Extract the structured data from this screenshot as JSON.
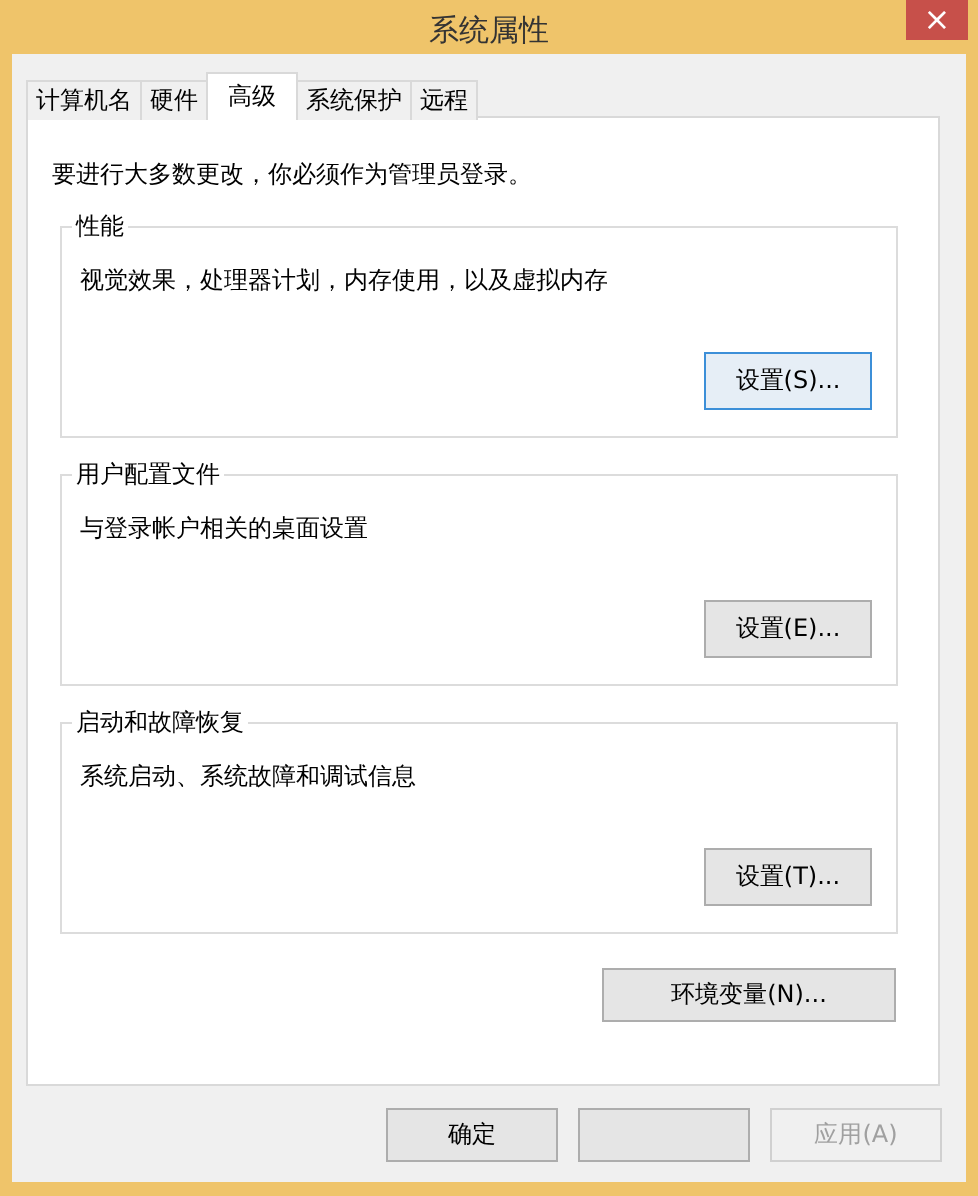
{
  "window": {
    "title": "系统属性",
    "close": "×"
  },
  "tabs": [
    {
      "label": "计算机名",
      "selected": false
    },
    {
      "label": "硬件",
      "selected": false
    },
    {
      "label": "高级",
      "selected": true
    },
    {
      "label": "系统保护",
      "selected": false
    },
    {
      "label": "远程",
      "selected": false
    }
  ],
  "notice": "要进行大多数更改，你必须作为管理员登录。",
  "groups": [
    {
      "title": "性能",
      "description": "视觉效果，处理器计划，内存使用，以及虚拟内存",
      "button": "设置(S)...",
      "focused": true
    },
    {
      "title": "用户配置文件",
      "description": "与登录帐户相关的桌面设置",
      "button": "设置(E)...",
      "focused": false
    },
    {
      "title": "启动和故障恢复",
      "description": "系统启动、系统故障和调试信息",
      "button": "设置(T)...",
      "focused": false
    }
  ],
  "env_button": "环境变量(N)...",
  "buttons": [
    {
      "label": "确定",
      "disabled": false
    },
    {
      "disabled": false
    },
    {
      "label": "应用(A)",
      "disabled": true
    }
  ]
}
